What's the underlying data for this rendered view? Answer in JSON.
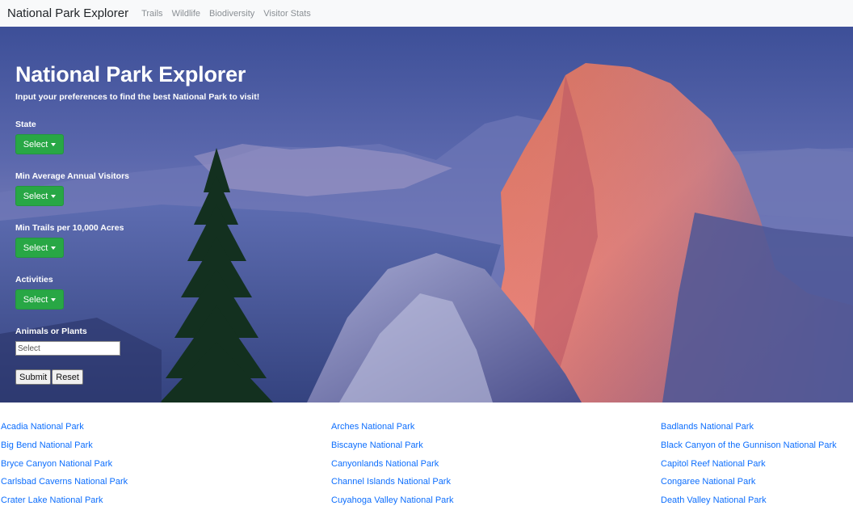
{
  "navbar": {
    "brand": "National Park Explorer",
    "links": [
      "Trails",
      "Wildlife",
      "Biodiversity",
      "Visitor Stats"
    ]
  },
  "hero": {
    "title": "National Park Explorer",
    "subtitle": "Input your preferences to find the best National Park to visit!",
    "filters": [
      {
        "label": "State",
        "button": "Select"
      },
      {
        "label": "Min Average Annual Visitors",
        "button": "Select"
      },
      {
        "label": "Min Trails per 10,000 Acres",
        "button": "Select"
      },
      {
        "label": "Activities",
        "button": "Select"
      }
    ],
    "species": {
      "label": "Animals or Plants",
      "placeholder": "Select"
    },
    "submit_label": "Submit",
    "reset_label": "Reset"
  },
  "parks": {
    "col1": [
      "Acadia National Park",
      "Big Bend National Park",
      "Bryce Canyon National Park",
      "Carlsbad Caverns National Park",
      "Crater Lake National Park"
    ],
    "col2": [
      "Arches National Park",
      "Biscayne National Park",
      "Canyonlands National Park",
      "Channel Islands National Park",
      "Cuyahoga Valley National Park"
    ],
    "col3": [
      "Badlands National Park",
      "Black Canyon of the Gunnison National Park",
      "Capitol Reef National Park",
      "Congaree National Park",
      "Death Valley National Park"
    ]
  },
  "colors": {
    "accent_green": "#28a745",
    "link_blue": "#0d6efd",
    "navbar_bg": "#f8f9fa"
  },
  "icons": {
    "dropdown": "caret-down-icon"
  }
}
